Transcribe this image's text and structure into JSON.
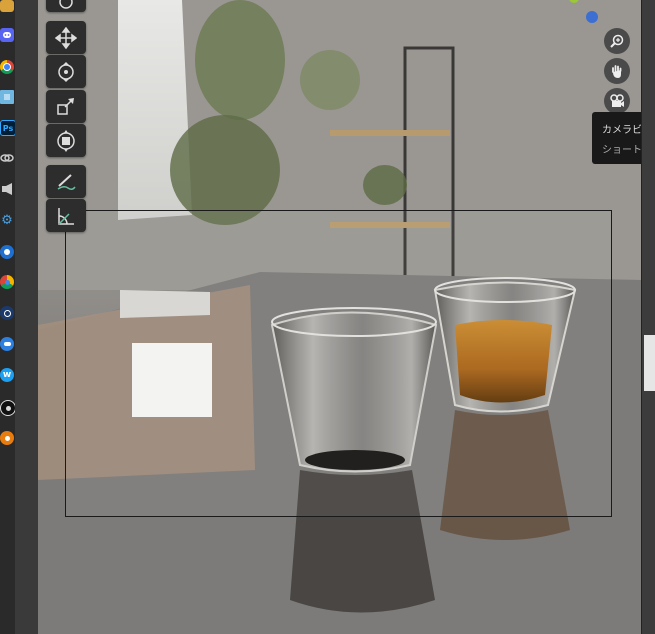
{
  "taskbar": {
    "icons": [
      "folder-icon",
      "discord-icon",
      "chrome-icon",
      "notepad-icon",
      "photoshop-icon",
      "link-icon",
      "media-icon",
      "settings-gear-icon",
      "blue-app-icon",
      "chrome-alt-icon",
      "steam-icon",
      "blue-circle-icon",
      "w-app-icon",
      "obs-icon",
      "blender-icon"
    ],
    "photoshop_label": "Ps"
  },
  "toolbar": {
    "tools": [
      "cursor-tool",
      "move-tool",
      "rotate-tool",
      "scale-tool",
      "transform-tool",
      "annotate-tool",
      "measure-tool"
    ]
  },
  "navigation": {
    "gizmo_colors": {
      "y_axis": "#9ac837",
      "z_axis": "#3c6fd1"
    },
    "buttons": [
      "zoom-icon",
      "hand-pan-icon",
      "camera-view-icon"
    ]
  },
  "tooltip": {
    "line1": "カメラビュ",
    "line2": "ショートカ"
  }
}
